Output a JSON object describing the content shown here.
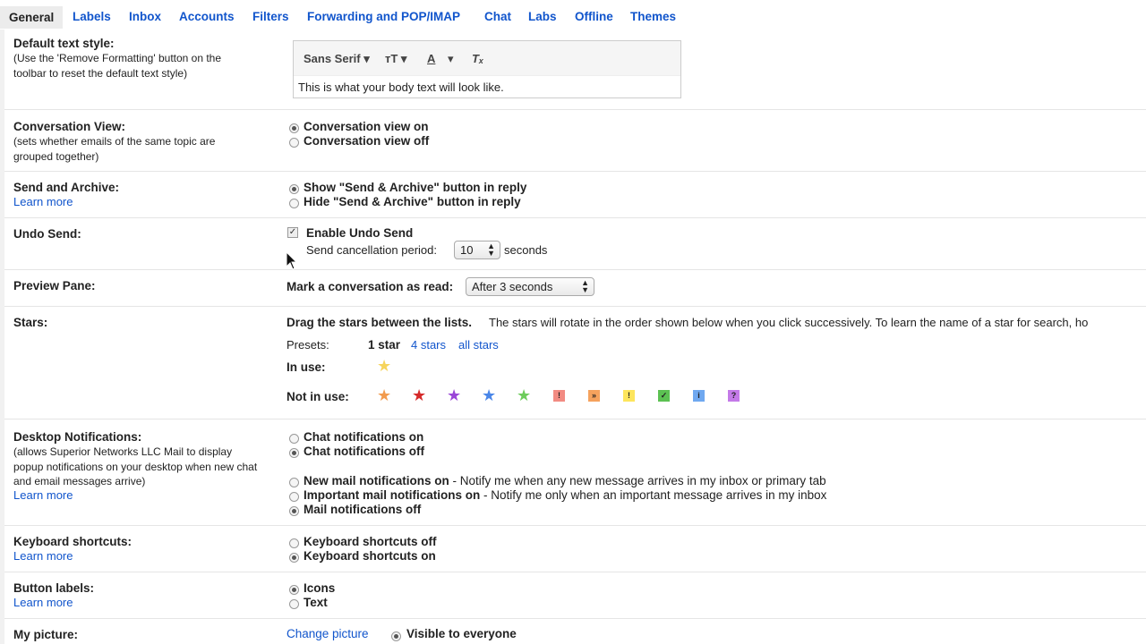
{
  "tabs": [
    "General",
    "Labels",
    "Inbox",
    "Accounts",
    "Filters",
    "Forwarding and POP/IMAP",
    "Chat",
    "Labs",
    "Offline",
    "Themes"
  ],
  "default_text_style": {
    "label": "Default text style:",
    "desc": "(Use the 'Remove Formatting' button on the toolbar to reset the default text style)",
    "font": "Sans Serif",
    "sample": "This is what your body text will look like."
  },
  "conversation_view": {
    "label": "Conversation View:",
    "desc": "(sets whether emails of the same topic are grouped together)",
    "on": "Conversation view on",
    "off": "Conversation view off"
  },
  "send_archive": {
    "label": "Send and Archive:",
    "learn": "Learn more",
    "show": "Show \"Send & Archive\" button in reply",
    "hide": "Hide \"Send & Archive\" button in reply"
  },
  "undo_send": {
    "label": "Undo Send:",
    "enable": "Enable Undo Send",
    "period_label": "Send cancellation period:",
    "period_value": "10",
    "seconds": "seconds"
  },
  "preview_pane": {
    "label": "Preview Pane:",
    "mark_label": "Mark a conversation as read:",
    "mark_value": "After 3 seconds"
  },
  "stars": {
    "label": "Stars:",
    "drag_bold": "Drag the stars between the lists.",
    "drag_rest": "The stars will rotate in the order shown below when you click successively. To learn the name of a star for search, ho",
    "presets_label": "Presets:",
    "preset_1": "1 star",
    "preset_4": "4 stars",
    "preset_all": "all stars",
    "in_use_label": "In use:",
    "not_in_use_label": "Not in use:",
    "colors": {
      "yellow": "#f6d45c",
      "orange": "#f29b4e",
      "red": "#d52a2a",
      "purple": "#9a46d7",
      "blue": "#4a86e8",
      "green": "#6dcc5b"
    }
  },
  "desktop_notifications": {
    "label": "Desktop Notifications:",
    "desc": "(allows Superior Networks LLC Mail to display popup notifications on your desktop when new chat and email messages arrive)",
    "learn": "Learn more",
    "chat_on": "Chat notifications on",
    "chat_off": "Chat notifications off",
    "new_mail_bold": "New mail notifications on",
    "new_mail_rest": " - Notify me when any new message arrives in my inbox or primary tab",
    "important_bold": "Important mail notifications on",
    "important_rest": " - Notify me only when an important message arrives in my inbox",
    "mail_off": "Mail notifications off"
  },
  "keyboard_shortcuts": {
    "label": "Keyboard shortcuts:",
    "learn": "Learn more",
    "off": "Keyboard shortcuts off",
    "on": "Keyboard shortcuts on"
  },
  "button_labels": {
    "label": "Button labels:",
    "learn": "Learn more",
    "icons": "Icons",
    "text": "Text"
  },
  "my_picture": {
    "label": "My picture:",
    "change": "Change picture",
    "visible": "Visible to everyone"
  }
}
